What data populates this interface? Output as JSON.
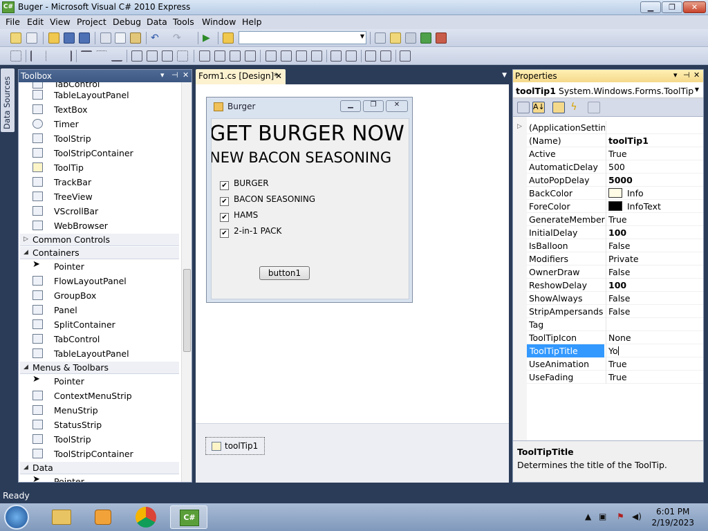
{
  "window": {
    "title": "Buger - Microsoft Visual C# 2010 Express",
    "app_icon": "C#"
  },
  "menu": [
    "File",
    "Edit",
    "View",
    "Project",
    "Debug",
    "Data",
    "Tools",
    "Window",
    "Help"
  ],
  "side_tab": {
    "label": "Data Sources"
  },
  "toolbox": {
    "title": "Toolbox",
    "top_items": [
      "TableLayoutPanel",
      "TextBox",
      "Timer",
      "ToolStrip",
      "ToolStripContainer",
      "ToolTip",
      "TrackBar",
      "TreeView",
      "VScrollBar",
      "WebBrowser"
    ],
    "categories": [
      {
        "label": "Common Controls",
        "expanded": false,
        "items": []
      },
      {
        "label": "Containers",
        "expanded": true,
        "items": [
          "Pointer",
          "FlowLayoutPanel",
          "GroupBox",
          "Panel",
          "SplitContainer",
          "TabControl",
          "TableLayoutPanel"
        ]
      },
      {
        "label": "Menus & Toolbars",
        "expanded": true,
        "items": [
          "Pointer",
          "ContextMenuStrip",
          "MenuStrip",
          "StatusStrip",
          "ToolStrip",
          "ToolStripContainer"
        ]
      },
      {
        "label": "Data",
        "expanded": true,
        "items": [
          "Pointer"
        ]
      }
    ]
  },
  "document": {
    "tab_label": "Form1.cs [Design]*",
    "form": {
      "title": "Burger",
      "heading1": "GET BURGER NOW",
      "heading2": "NEW BACON SEASONING",
      "checkboxes": [
        "BURGER",
        "BACON SEASONING",
        "HAMS",
        "2-in-1 PACK"
      ],
      "button": "button1"
    },
    "tray_component": "toolTip1"
  },
  "properties": {
    "title": "Properties",
    "object_name": "toolTip1",
    "object_type": "System.Windows.Forms.ToolTip",
    "rows": [
      {
        "name": "(ApplicationSettings",
        "value": "",
        "expand": true
      },
      {
        "name": "(Name)",
        "value": "toolTip1",
        "bold": true
      },
      {
        "name": "Active",
        "value": "True"
      },
      {
        "name": "AutomaticDelay",
        "value": "500"
      },
      {
        "name": "AutoPopDelay",
        "value": "5000",
        "bold": true
      },
      {
        "name": "BackColor",
        "value": "Info",
        "swatch": "#fffbe5"
      },
      {
        "name": "ForeColor",
        "value": "InfoText",
        "swatch": "#000000"
      },
      {
        "name": "GenerateMember",
        "value": "True"
      },
      {
        "name": "InitialDelay",
        "value": "100",
        "bold": true
      },
      {
        "name": "IsBalloon",
        "value": "False"
      },
      {
        "name": "Modifiers",
        "value": "Private"
      },
      {
        "name": "OwnerDraw",
        "value": "False"
      },
      {
        "name": "ReshowDelay",
        "value": "100",
        "bold": true
      },
      {
        "name": "ShowAlways",
        "value": "False"
      },
      {
        "name": "StripAmpersands",
        "value": "False"
      },
      {
        "name": "Tag",
        "value": ""
      },
      {
        "name": "ToolTipIcon",
        "value": "None"
      },
      {
        "name": "ToolTipTitle",
        "value": "Yo",
        "selected": true
      },
      {
        "name": "UseAnimation",
        "value": "True"
      },
      {
        "name": "UseFading",
        "value": "True"
      }
    ],
    "description_title": "ToolTipTitle",
    "description_text": "Determines the title of the ToolTip."
  },
  "status": {
    "text": "Ready"
  },
  "taskbar": {
    "time": "6:01 PM",
    "date": "2/19/2023"
  },
  "colors": {
    "selection": "#3399ff",
    "panel_header": "#4e6a94",
    "ide_background": "#2b3c59"
  }
}
